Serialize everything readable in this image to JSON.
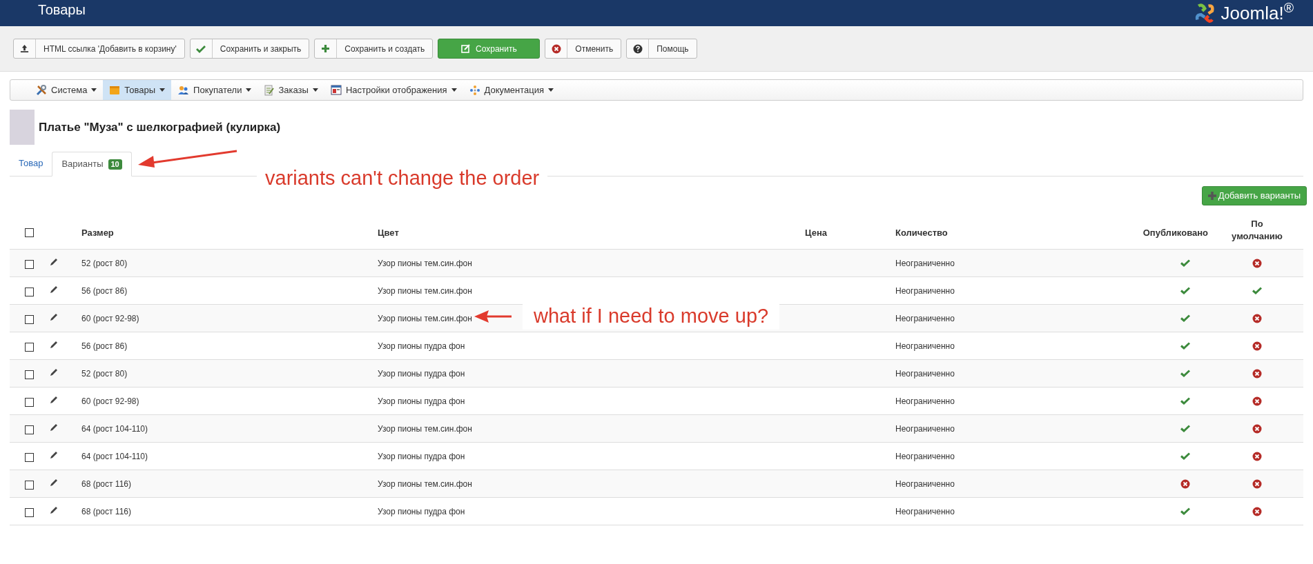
{
  "header": {
    "title": "Товары",
    "logo": "Joomla!$^{®}$"
  },
  "toolbar": [
    {
      "kind": "upload",
      "label": "HTML ссылка 'Добавить в корзину'"
    },
    {
      "kind": "check",
      "label": "Сохранить и закрыть"
    },
    {
      "kind": "plus",
      "label": "Сохранить и создать"
    },
    {
      "kind": "save",
      "label": "Сохранить"
    },
    {
      "kind": "cancel",
      "label": "Отменить"
    },
    {
      "kind": "help",
      "label": "Помощь"
    }
  ],
  "menu": [
    {
      "kind": "tools",
      "label": "Система",
      "selected": false
    },
    {
      "kind": "box",
      "label": "Товары",
      "selected": true
    },
    {
      "kind": "users",
      "label": "Покупатели",
      "selected": false
    },
    {
      "kind": "orders",
      "label": "Заказы",
      "selected": false
    },
    {
      "kind": "display",
      "label": "Настройки отображения",
      "selected": false
    },
    {
      "kind": "docs",
      "label": "Документация",
      "selected": false
    }
  ],
  "product": {
    "title": "Платье \"Муза\" с шелкографией (кулирка)"
  },
  "tabs": [
    {
      "label": "Товар",
      "selected": false
    },
    {
      "label": "Варианты",
      "badge": "10",
      "selected": true
    }
  ],
  "add_button": {
    "label": "Добавить варианты"
  },
  "table": {
    "columns": [
      "Размер",
      "Цвет",
      "Цена",
      "Количество",
      "Опубликовано",
      "По умолчанию"
    ],
    "select_all": {
      "checked": false
    },
    "rows": [
      {
        "checked": false,
        "size": "52 (рост 80)",
        "variant_color": "Узор пионы тем.син.фон",
        "quantity": "Неограниченно",
        "published": true,
        "default": false
      },
      {
        "checked": false,
        "size": "56 (рост 86)",
        "variant_color": "Узор пионы тем.син.фон",
        "quantity": "Неограниченно",
        "published": true,
        "default": true
      },
      {
        "checked": false,
        "size": "60 (рост 92-98)",
        "variant_color": "Узор пионы тем.син.фон",
        "quantity": "Неограниченно",
        "published": true,
        "default": false
      },
      {
        "checked": false,
        "size": "56 (рост 86)",
        "variant_color": "Узор пионы пудра фон",
        "quantity": "Неограниченно",
        "published": true,
        "default": false
      },
      {
        "checked": false,
        "size": "52 (рост 80)",
        "variant_color": "Узор пионы пудра фон",
        "quantity": "Неограниченно",
        "published": true,
        "default": false
      },
      {
        "checked": false,
        "size": "60 (рост 92-98)",
        "variant_color": "Узор пионы пудра фон",
        "quantity": "Неограниченно",
        "published": true,
        "default": false
      },
      {
        "checked": false,
        "size": "64 (рост 104-110)",
        "variant_color": "Узор пионы тем.син.фон",
        "quantity": "Неограниченно",
        "published": true,
        "default": false
      },
      {
        "checked": false,
        "size": "64 (рост 104-110)",
        "variant_color": "Узор пионы пудра фон",
        "quantity": "Неограниченно",
        "published": true,
        "default": false
      },
      {
        "checked": false,
        "size": "68 (рост 116)",
        "variant_color": "Узор пионы тем.син.фон",
        "quantity": "Неограниченно",
        "published": false,
        "default": false
      },
      {
        "checked": false,
        "size": "68 (рост 116)",
        "variant_color": "Узор пионы пудра фон",
        "quantity": "Неограниченно",
        "published": true,
        "default": false
      }
    ]
  },
  "annotations": [
    {
      "text": "variants can't change the order"
    },
    {
      "text": "what if I need to move up?"
    }
  ]
}
